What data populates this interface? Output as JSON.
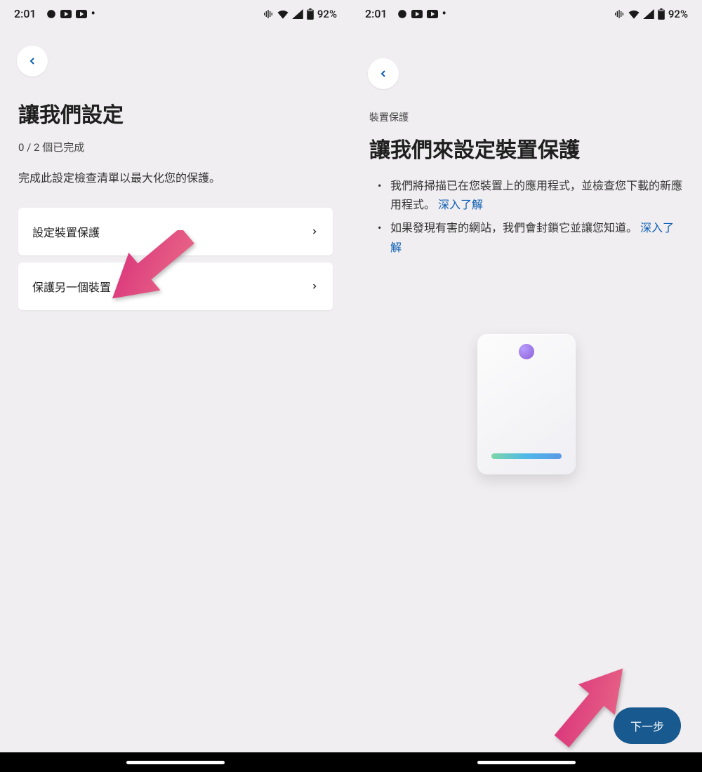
{
  "status": {
    "time": "2:01",
    "battery_text": "92%"
  },
  "screen1": {
    "title": "讓我們設定",
    "progress": "0 / 2 個已完成",
    "description": "完成此設定檢查清單以最大化您的保護。",
    "card1_label": "設定裝置保護",
    "card2_label": "保護另一個裝置"
  },
  "screen2": {
    "eyebrow": "裝置保護",
    "title": "讓我們來設定裝置保護",
    "bullet1a": "我們將掃描已在您裝置上的應用程式，並檢查您下載的新應用程式。",
    "bullet1_link": "深入了解",
    "bullet2a": "如果發現有害的網站，我們會封鎖它並讓您知道。",
    "bullet2_link": "深入了解",
    "next_button": "下一步"
  }
}
